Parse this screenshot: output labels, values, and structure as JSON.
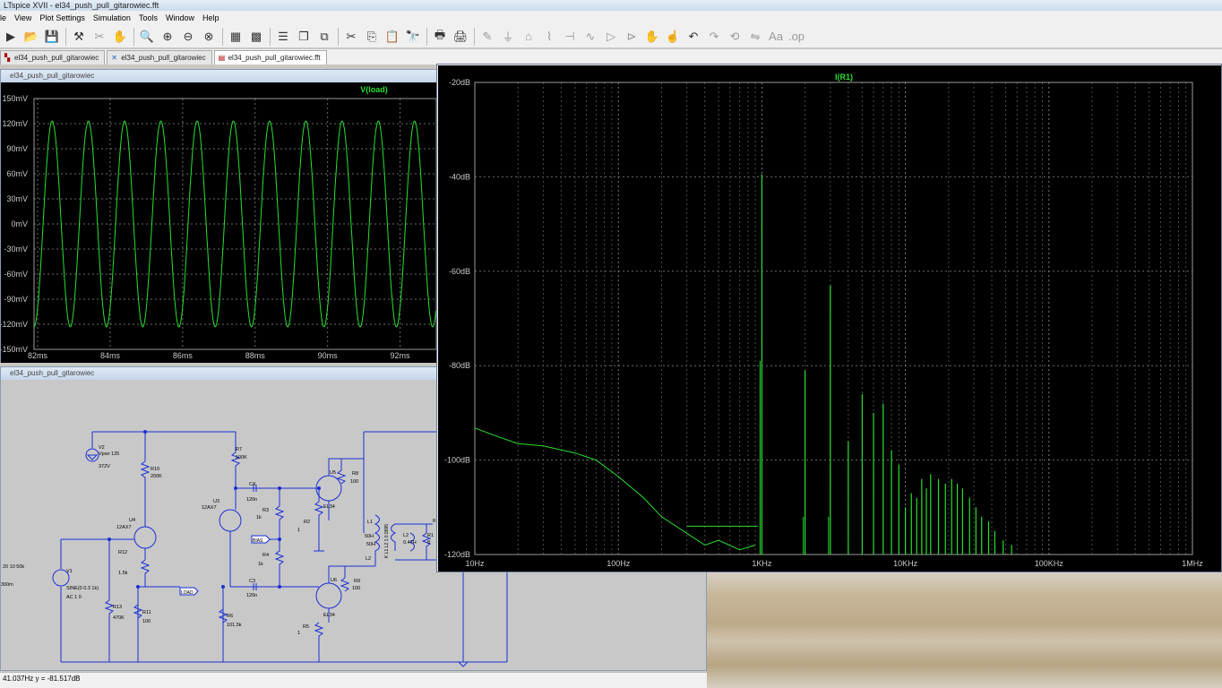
{
  "app": {
    "title": "LTspice XVII - el34_push_pull_gitarowiec.fft"
  },
  "menu": [
    "le",
    "View",
    "Plot Settings",
    "Simulation",
    "Tools",
    "Window",
    "Help"
  ],
  "tabs": [
    {
      "label": "el34_push_pull_gitarowiec",
      "active": false
    },
    {
      "label": "el34_push_pull_gitarowiec",
      "active": false
    },
    {
      "label": "el34_push_pull_gitarowiec.fft",
      "active": true
    }
  ],
  "transient_window": {
    "title": "el34_push_pull_gitarowiec",
    "chart_data": {
      "type": "line",
      "title": "V(load)",
      "x_ticks": [
        "82ms",
        "84ms",
        "86ms",
        "88ms",
        "90ms",
        "92ms"
      ],
      "y_ticks": [
        "150mV",
        "120mV",
        "90mV",
        "60mV",
        "30mV",
        "0mV",
        "-30mV",
        "-60mV",
        "-90mV",
        "-120mV",
        "-150mV"
      ],
      "xlim": [
        81.9,
        93.0
      ],
      "ylim": [
        -150,
        150
      ],
      "series": [
        {
          "name": "V(load)",
          "amplitude_mV": 123,
          "frequency_Hz": 1000,
          "color": "#27e02e"
        }
      ]
    }
  },
  "fft_window": {
    "chart_data": {
      "type": "line",
      "title": "I(R1)",
      "x_ticks": [
        "10Hz",
        "100Hz",
        "1KHz",
        "10KHz",
        "100KHz",
        "1MHz"
      ],
      "y_ticks": [
        "-20dB",
        "-40dB",
        "-60dB",
        "-80dB",
        "-100dB",
        "-120dB"
      ],
      "xlim_Hz": [
        10,
        1000000
      ],
      "ylim_dB": [
        -120,
        -20
      ],
      "x_scale": "log",
      "series": [
        {
          "name": "I(R1)",
          "color": "#27e02e",
          "noise_floor": [
            [
              10,
              -93.2
            ],
            [
              15,
              -95.2
            ],
            [
              20,
              -96.5
            ],
            [
              30,
              -97
            ],
            [
              50,
              -98.5
            ],
            [
              70,
              -100
            ],
            [
              100,
              -103.5
            ],
            [
              150,
              -108
            ],
            [
              200,
              -112
            ],
            [
              300,
              -115.5
            ],
            [
              400,
              -118
            ],
            [
              500,
              -117
            ],
            [
              700,
              -119
            ],
            [
              900,
              -118
            ]
          ],
          "peaks": [
            [
              1000,
              -39.5
            ],
            [
              2000,
              -81
            ],
            [
              3000,
              -63
            ],
            [
              4000,
              -96
            ],
            [
              5000,
              -86
            ],
            [
              6000,
              -90
            ],
            [
              7000,
              -88
            ],
            [
              8000,
              -98
            ],
            [
              9000,
              -101
            ],
            [
              10000,
              -110
            ],
            [
              11000,
              -107
            ],
            [
              12000,
              -108
            ],
            [
              13000,
              -104
            ],
            [
              14000,
              -106
            ],
            [
              15000,
              -103
            ],
            [
              17000,
              -104
            ],
            [
              19000,
              -105
            ],
            [
              21000,
              -104
            ],
            [
              23000,
              -105
            ],
            [
              25000,
              -106
            ],
            [
              28000,
              -108
            ],
            [
              31000,
              -110
            ],
            [
              34000,
              -112
            ],
            [
              38000,
              -113
            ],
            [
              42000,
              -115
            ],
            [
              48000,
              -117
            ],
            [
              55000,
              -118
            ]
          ]
        }
      ]
    }
  },
  "schematic_window": {
    "title": "el34_push_pull_gitarowiec",
    "labels": {
      "v2": "V2",
      "v2_val": "Vpwr 125",
      "v2_val2": "372V",
      "r10": "R10",
      "r10_val": "200K",
      "r7": "R7",
      "r7_val": "100K",
      "c4": "C4",
      "c4_val": "120n",
      "u3": "U3",
      "u3_val": "12AX7",
      "u4": "U4",
      "u4_val": "12AX7",
      "r3": "R3",
      "r3_val": "1k",
      "r2": "R2",
      "r2_val": "1",
      "bias": "BIAS",
      "r4": "R4",
      "r4_val": "1k",
      "u5": "U5",
      "u5_val": "EL34",
      "r8": "R8",
      "r8_val": "100",
      "l1": "L1",
      "l1_val": "50H",
      "l1_val2": "50H",
      "l2": "L2",
      "l2_val": "0.47H",
      "r1": "R1",
      "r1_val": "8",
      "r12": "R12",
      "r12_val": "1.5k",
      "v1": "V1",
      "v1_val": "SINE(0 0.3 1k)",
      "v1_val2": "AC 1 0",
      "v1_left": "20 10 50k",
      "v1_left2": "300m",
      "load": "LOAD",
      "r13": "R13",
      "r13_val": "470K",
      "r11": "R11",
      "r11_val": "100",
      "c3": "C3",
      "c3_val": "120n",
      "r6": "R6",
      "r6_val": "101.5k",
      "u6": "U6",
      "u6_val": "EL34",
      "r9": "R9",
      "r9_val": "100",
      "r5": "R5",
      "r5_val": "1",
      "k": "K L1 L2 1 0.9995",
      "r_out": "R"
    }
  },
  "status": {
    "cursor_text": "41.037Hz   y = -81.517dB"
  }
}
